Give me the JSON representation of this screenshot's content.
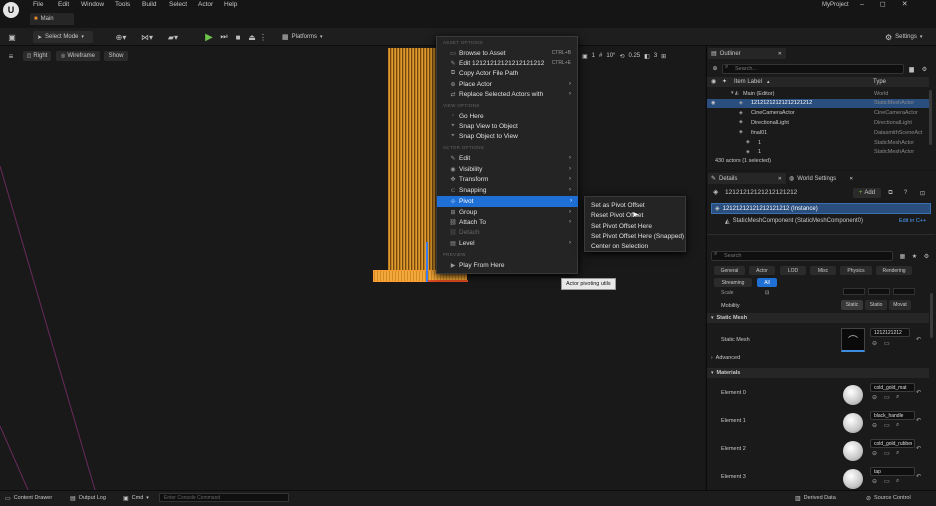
{
  "menubar": {
    "items": [
      "File",
      "Edit",
      "Window",
      "Tools",
      "Build",
      "Select",
      "Actor",
      "Help"
    ],
    "project": "MyProject",
    "tab": "Main"
  },
  "toolbar": {
    "select_mode": "Select Mode",
    "platforms": "Platforms",
    "settings": "Settings"
  },
  "viewport": {
    "perspective": "Right",
    "view_mode": "Wireframe",
    "show": "Show",
    "grid": "10",
    "rot": "10°",
    "scale": "0.25",
    "cam": "3",
    "layers": "1"
  },
  "context_menu": {
    "sec_asset": "ASSET OPTIONS",
    "browse": "Browse to Asset",
    "browse_sc": "CTRL+B",
    "edit": "Edit 12121212121212121212",
    "edit_sc": "CTRL+E",
    "copy_path": "Copy Actor File Path",
    "place_actor": "Place Actor",
    "replace": "Replace Selected Actors with",
    "sec_view": "VIEW OPTIONS",
    "go_here": "Go Here",
    "snap_view": "Snap View to Object",
    "snap_object": "Snap Object to View",
    "sec_actor": "ACTOR OPTIONS",
    "edit_sub": "Edit",
    "visibility": "Visibility",
    "transform": "Transform",
    "snapping": "Snapping",
    "pivot": "Pivot",
    "group": "Group",
    "attach": "Attach To",
    "detach": "Detach",
    "level": "Level",
    "sec_preview": "PREVIEW",
    "play_from_here": "Play From Here"
  },
  "pivot_submenu": {
    "items": [
      "Set as Pivot Offset",
      "Reset Pivot Offset",
      "Set Pivot Offset Here",
      "Set Pivot Offset Here (Snapped)",
      "Center on Selection"
    ],
    "tooltip": "Actor pivoting utils"
  },
  "outliner": {
    "title": "Outliner",
    "search": "Search...",
    "col_label": "Item Label",
    "col_type": "Type",
    "rows": [
      {
        "label": "Main (Editor)",
        "type": "World"
      },
      {
        "label": "12121212121212121212",
        "type": "StaticMeshActor"
      },
      {
        "label": "CineCameraActor",
        "type": "CineCameraActor"
      },
      {
        "label": "DirectionalLight",
        "type": "DirectionalLight"
      },
      {
        "label": "final01",
        "type": "DatasmithSceneAct"
      },
      {
        "label": "1",
        "type": "StaticMeshActor"
      },
      {
        "label": "1",
        "type": "StaticMeshActor"
      }
    ],
    "count": "430 actors (1 selected)"
  },
  "details": {
    "title": "Details",
    "world_settings": "World Settings",
    "actor_name": "12121212121212121212",
    "add": "Add",
    "instance": "12121212121212121212 (Instance)",
    "component": "StaticMeshComponent (StaticMeshComponent0)",
    "edit_cpp": "Edit in C++",
    "search": "Search",
    "filters": [
      "General",
      "Actor",
      "LOD",
      "Misc",
      "Physics",
      "Rendering",
      "Streaming",
      "All"
    ],
    "scale": "Scale",
    "mobility": "Mobility",
    "mob_opts": [
      "Static",
      "Statio",
      "Movat"
    ],
    "sec_static_mesh": "Static Mesh",
    "static_mesh_label": "Static Mesh",
    "static_mesh_val": "1212121212",
    "advanced": "Advanced",
    "sec_materials": "Materials",
    "elements": [
      {
        "label": "Element 0",
        "mat": "cold_gold_mat"
      },
      {
        "label": "Element 1",
        "mat": "black_handle"
      },
      {
        "label": "Element 2",
        "mat": "cold_gold_rubber"
      },
      {
        "label": "Element 3",
        "mat": "tap"
      }
    ]
  },
  "statusbar": {
    "content_drawer": "Content Drawer",
    "output_log": "Output Log",
    "cmd": "Cmd",
    "console": "Enter Console Command",
    "derived": "Derived Data",
    "source": "Source Control"
  }
}
